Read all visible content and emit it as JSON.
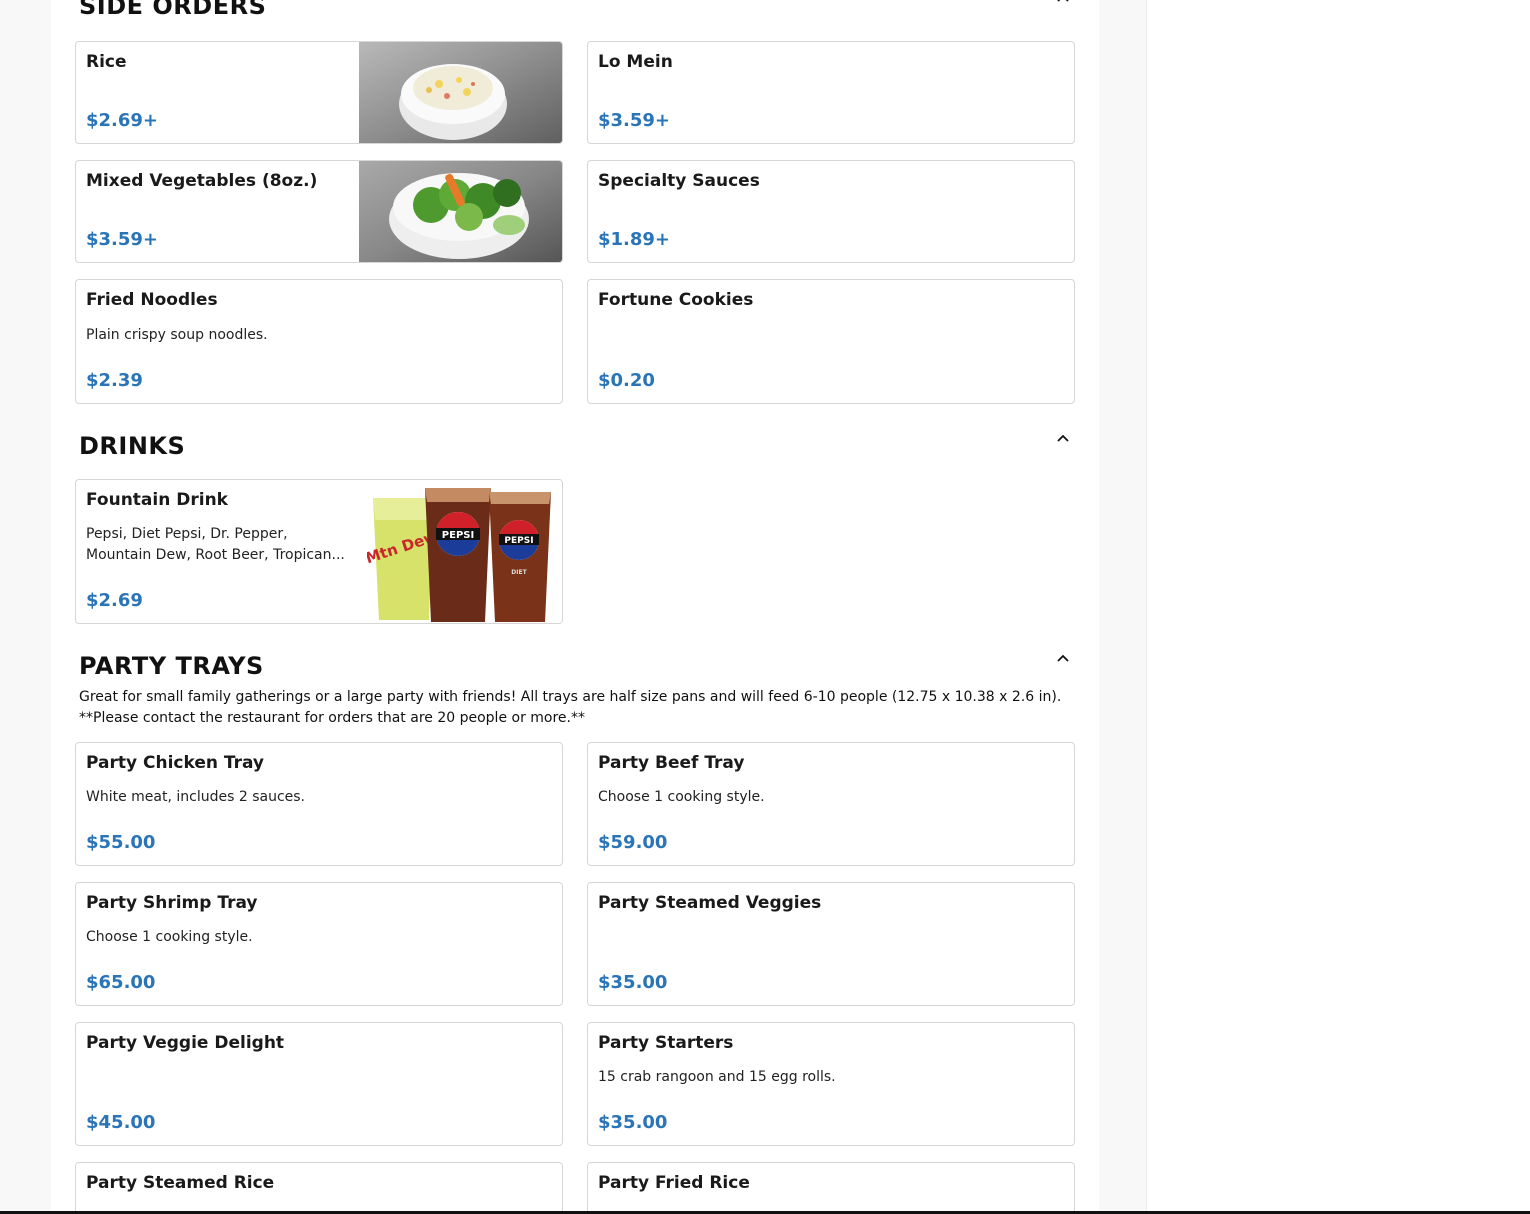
{
  "sections": {
    "side_orders": {
      "title": "SIDE ORDERS",
      "items": [
        {
          "name": "Rice",
          "price": "$2.69+",
          "image": "fried-rice-bowl-photo"
        },
        {
          "name": "Lo Mein",
          "price": "$3.59+"
        },
        {
          "name": "Mixed Vegetables (8oz.)",
          "price": "$3.59+",
          "image": "mixed-vegetables-bowl-photo"
        },
        {
          "name": "Specialty Sauces",
          "price": "$1.89+"
        },
        {
          "name": "Fried Noodles",
          "description": "Plain crispy soup noodles.",
          "price": "$2.39"
        },
        {
          "name": "Fortune Cookies",
          "price": "$0.20"
        }
      ]
    },
    "drinks": {
      "title": "DRINKS",
      "items": [
        {
          "name": "Fountain Drink",
          "description_line1": "Pepsi, Diet Pepsi, Dr. Pepper,",
          "description_line2": "Mountain Dew, Root Beer, Tropican...",
          "price": "$2.69",
          "image": "fountain-drinks-photo",
          "image_labels": [
            "Mtn Dew",
            "PEPSI",
            "PEPSI",
            "DIET"
          ]
        }
      ]
    },
    "party_trays": {
      "title": "PARTY TRAYS",
      "description_line1": "Great for small family gatherings or a large party with friends! All trays are half size pans and will feed 6-10 people (12.75 x 10.38 x 2.6 in).",
      "description_line2": "**Please contact the restaurant for orders that are 20 people or more.**",
      "items": [
        {
          "name": "Party Chicken Tray",
          "description": "White meat, includes 2 sauces.",
          "price": "$55.00"
        },
        {
          "name": "Party Beef Tray",
          "description": "Choose 1 cooking style.",
          "price": "$59.00"
        },
        {
          "name": "Party Shrimp Tray",
          "description": "Choose 1 cooking style.",
          "price": "$65.00"
        },
        {
          "name": "Party Steamed Veggies",
          "price": "$35.00"
        },
        {
          "name": "Party Veggie Delight",
          "price": "$45.00"
        },
        {
          "name": "Party Starters",
          "description": "15 crab rangoon and 15 egg rolls.",
          "price": "$35.00"
        },
        {
          "name": "Party Steamed Rice"
        },
        {
          "name": "Party Fried Rice"
        }
      ]
    }
  },
  "colors": {
    "price": "#2a74b8",
    "card_border": "#d6d6d6",
    "page_bg": "#f8f8f8"
  },
  "icons": {
    "collapse": "chevron-up-icon"
  }
}
